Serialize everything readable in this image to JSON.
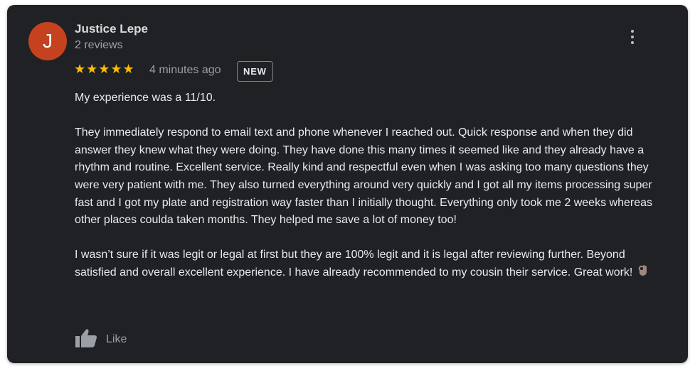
{
  "review": {
    "author_initial": "J",
    "author_name": "Justice Lepe",
    "author_reviews": "2 reviews",
    "rating": 5,
    "stars_text": "★★★★★",
    "time": "4 minutes ago",
    "badge": "NEW",
    "paragraphs": [
      "My experience was a 11/10.",
      "They immediately respond to email text and phone whenever I reached out. Quick response and when they did answer they knew what they were doing. They have done this many times it seemed like and they already have a rhythm and routine. Excellent service. Really kind and respectful even when I was asking too many questions they were very patient with me. They also turned everything around very quickly and I got all my items processing super fast and I got my plate and registration way faster than I initially thought. Everything only took me 2 weeks whereas other places coulda taken months. They helped me save a lot of money too!",
      "I wasn’t sure if it was legit or legal at first but they are 100% legit and it is legal after reviewing further. Beyond satisfied and overall excellent experience. I have already recommended to my cousin their service. Great work!"
    ],
    "emoji_icon": "ok-hand-icon",
    "like_label": "Like",
    "menu_icon": "more-vertical-icon"
  },
  "colors": {
    "card_background": "#202124",
    "avatar_background": "#c5421e",
    "star_color": "#fbbc04",
    "primary_text": "#e8eaed",
    "secondary_text": "#9aa0a6"
  }
}
